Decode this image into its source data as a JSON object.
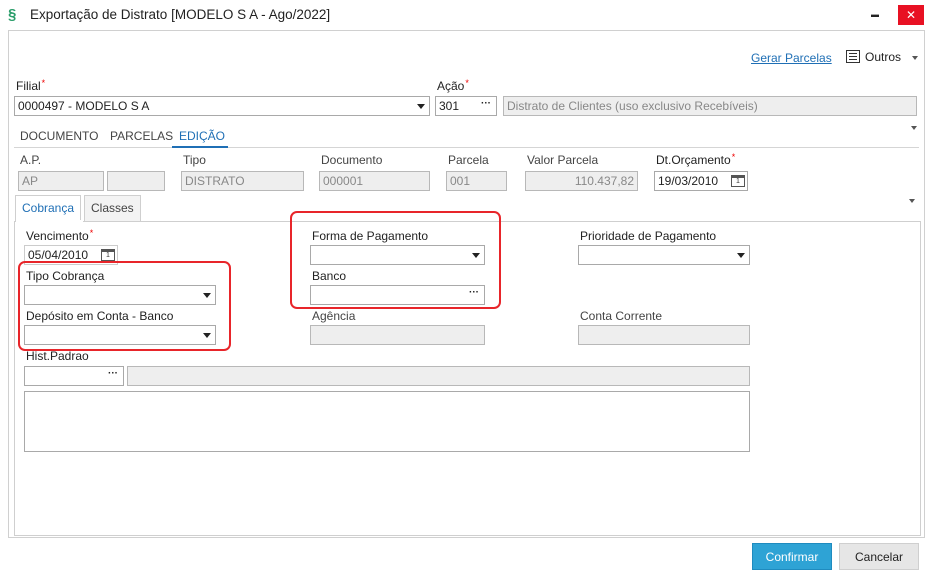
{
  "window": {
    "title": "Exportação de Distrato [MODELO S A - Ago/2022]",
    "logo_glyph": "§",
    "minimize_glyph": "▬",
    "maximize_glyph": "□",
    "close_glyph": "✕"
  },
  "toolbar": {
    "gerar_parcelas": "Gerar Parcelas",
    "outros": "Outros"
  },
  "header": {
    "filial_label": "Filial",
    "filial_value": "0000497 - MODELO S A",
    "acao_label": "Ação",
    "acao_code": "301",
    "acao_description": "Distrato de Clientes (uso exclusivo Recebíveis)",
    "required_marker": "*"
  },
  "tabs": [
    {
      "label": "DOCUMENTO",
      "active": false
    },
    {
      "label": "PARCELAS",
      "active": false
    },
    {
      "label": "EDIÇÃO",
      "active": true
    }
  ],
  "info": {
    "ap_label": "A.P.",
    "ap_value": "AP",
    "ap_value2": "",
    "tipo_label": "Tipo",
    "tipo_value": "DISTRATO",
    "documento_label": "Documento",
    "documento_value": "000001",
    "parcela_label": "Parcela",
    "parcela_value": "001",
    "valor_parcela_label": "Valor Parcela",
    "valor_parcela_value": "110.437,82",
    "dt_orcamento_label": "Dt.Orçamento",
    "dt_orcamento_value": "19/03/2010"
  },
  "sub_tabs": [
    {
      "label": "Cobrança",
      "active": true
    },
    {
      "label": "Classes",
      "active": false
    }
  ],
  "cobranca": {
    "vencimento_label": "Vencimento",
    "vencimento_value": "05/04/2010",
    "forma_pagamento_label": "Forma de Pagamento",
    "forma_pagamento_value": "",
    "prioridade_label": "Prioridade de Pagamento",
    "prioridade_value": "",
    "tipo_cobranca_label": "Tipo Cobrança",
    "tipo_cobranca_value": "",
    "banco_label": "Banco",
    "banco_value": "",
    "deposito_label": "Depósito em Conta - Banco",
    "deposito_value": "",
    "agencia_label": "Agência",
    "agencia_value": "",
    "conta_corrente_label": "Conta Corrente",
    "conta_corrente_value": "",
    "hist_padrao_label": "Hist.Padrao",
    "hist_padrao_code": "",
    "hist_padrao_desc": "",
    "memo_value": ""
  },
  "footer": {
    "confirmar": "Confirmar",
    "cancelar": "Cancelar"
  },
  "colors": {
    "accent": "#1f6fb5",
    "confirm_button": "#2ea3d5",
    "highlight_box": "#e8252a",
    "close_button": "#e81123",
    "required": "#ee0000"
  }
}
